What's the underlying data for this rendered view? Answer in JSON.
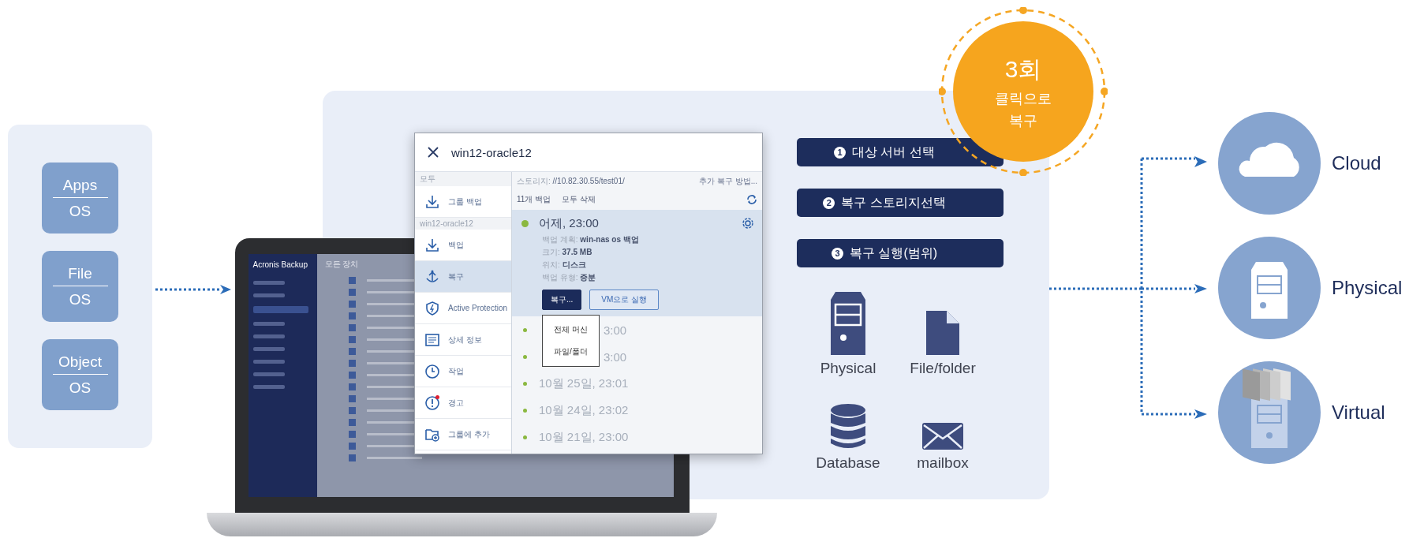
{
  "source_panel": {
    "items": [
      {
        "top": "Apps",
        "bottom": "OS"
      },
      {
        "top": "File",
        "bottom": "OS"
      },
      {
        "top": "Object",
        "bottom": "OS"
      }
    ]
  },
  "laptop_app": {
    "logo": "Acronis Backup",
    "header": "모든 장치"
  },
  "window": {
    "title": "win12-oracle12"
  },
  "nav": [
    {
      "kind": "section",
      "label": "모두"
    },
    {
      "kind": "item",
      "label": "그룹 백업",
      "selected": false,
      "alert": false
    },
    {
      "kind": "section",
      "label": "win12-oracle12"
    },
    {
      "kind": "item",
      "label": "백업",
      "selected": false,
      "alert": false
    },
    {
      "kind": "item",
      "label": "복구",
      "selected": true,
      "alert": false
    },
    {
      "kind": "item",
      "label": "Active Protection",
      "selected": false,
      "alert": false
    },
    {
      "kind": "item",
      "label": "상세 정보",
      "selected": false,
      "alert": false
    },
    {
      "kind": "item",
      "label": "작업",
      "selected": false,
      "alert": false
    },
    {
      "kind": "item",
      "label": "경고",
      "selected": false,
      "alert": true
    },
    {
      "kind": "item",
      "label": "그룹에 추가",
      "selected": false,
      "alert": false
    }
  ],
  "storage": {
    "label": "스토리지:",
    "value": "//10.82.30.55/test01/",
    "link": "추가 복구 방법..."
  },
  "backup_count": "11개 백업",
  "delete_all": "모두 삭제",
  "backups": [
    {
      "time": "어제, 23:00",
      "selected": true,
      "details": [
        {
          "label": "백업 계획:",
          "value": "win-nas os 백업"
        },
        {
          "label": "크기:",
          "value": "37.5 MB"
        },
        {
          "label": "위치:",
          "value": "디스크"
        },
        {
          "label": "백업 유형:",
          "value": "증분"
        }
      ],
      "actions": [
        {
          "kind": "primary",
          "label": "복구..."
        },
        {
          "kind": "outline",
          "label": "VM으로 실행"
        }
      ]
    },
    {
      "time": "3:00",
      "selected": false,
      "obscured": true
    },
    {
      "time": "3:00",
      "selected": false,
      "obscured": true
    },
    {
      "time": "10월 25일, 23:01",
      "selected": false
    },
    {
      "time": "10월 24일, 23:02",
      "selected": false
    },
    {
      "time": "10월 21일, 23:00",
      "selected": false
    }
  ],
  "menu": [
    "전체 머신",
    "파일/폴더"
  ],
  "steps": [
    {
      "number": "1",
      "label": "대상 서버 선택"
    },
    {
      "number": "2",
      "label": "복구 스토리지선택"
    },
    {
      "number": "3",
      "label": "복구 실행(범위)"
    }
  ],
  "badge": {
    "count": "3회",
    "lines": [
      "클릭으로",
      "복구"
    ]
  },
  "sources": [
    {
      "kind": "physical",
      "label": "Physical"
    },
    {
      "kind": "file",
      "label": "File/folder"
    },
    {
      "kind": "database",
      "label": "Database"
    },
    {
      "kind": "mail",
      "label": "mailbox"
    }
  ],
  "targets": [
    {
      "kind": "cloud",
      "label": "Cloud"
    },
    {
      "kind": "physical",
      "label": "Physical"
    },
    {
      "kind": "virtual",
      "label": "Virtual"
    }
  ]
}
